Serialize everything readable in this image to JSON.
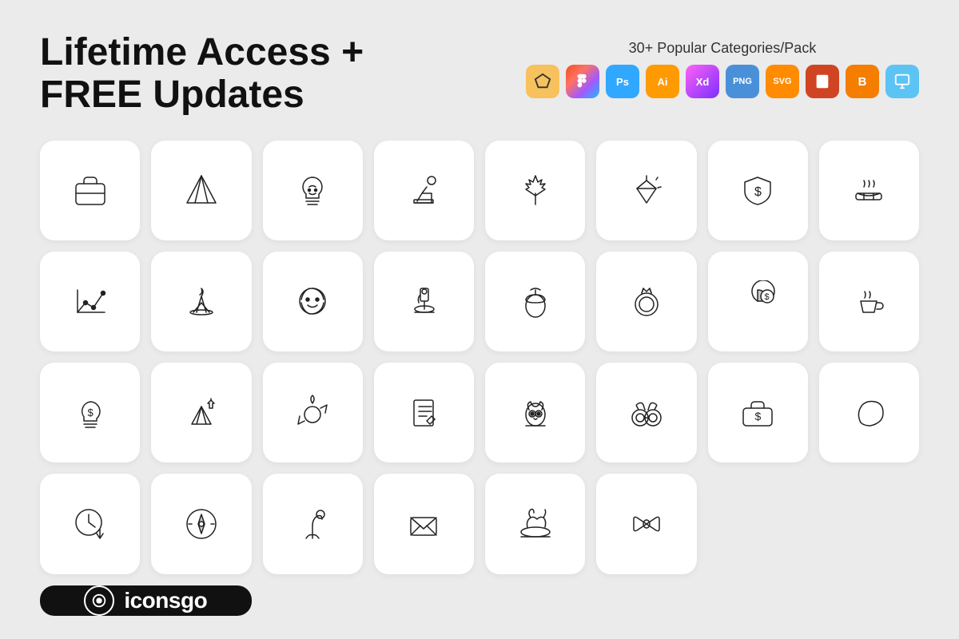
{
  "header": {
    "headline_line1": "Lifetime Access +",
    "headline_line2": "FREE Updates",
    "categories_text": "30+ Popular Categories/Pack"
  },
  "badges": [
    {
      "id": "sketch",
      "label": "S",
      "class": "badge-sketch"
    },
    {
      "id": "figma",
      "label": "F",
      "class": "badge-figma"
    },
    {
      "id": "ps",
      "label": "Ps",
      "class": "badge-ps"
    },
    {
      "id": "ai",
      "label": "Ai",
      "class": "badge-ai"
    },
    {
      "id": "xd",
      "label": "Xd",
      "class": "badge-xd"
    },
    {
      "id": "png",
      "label": "PNG",
      "class": "badge-png"
    },
    {
      "id": "svg",
      "label": "SVG",
      "class": "badge-svg"
    },
    {
      "id": "ppt",
      "label": "P",
      "class": "badge-ppt"
    },
    {
      "id": "blogger",
      "label": "B",
      "class": "badge-blogger"
    },
    {
      "id": "keynote",
      "label": "K",
      "class": "badge-keynote"
    }
  ],
  "brand": {
    "name": "iconsgo"
  }
}
